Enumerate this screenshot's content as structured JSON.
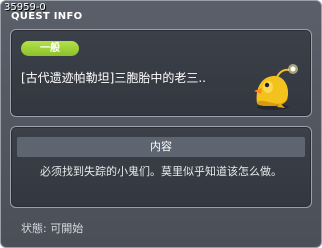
{
  "window": {
    "quest_id": "35959-0",
    "title": "QUEST INFO"
  },
  "quest": {
    "category_badge": "一般",
    "name": "[古代遗迹帕勒坦]三胞胎中的老三..",
    "npc_icon": "yellow-chick-npc-icon"
  },
  "content": {
    "header": "内容",
    "text": "必须找到失踪的小鬼们。莫里似乎知道该怎么做。"
  },
  "status": {
    "text": "状態: 可開始"
  },
  "colors": {
    "badge": "#8bc12a",
    "window_bg": "#4a4f58",
    "panel_border": "#9aa3ad"
  }
}
